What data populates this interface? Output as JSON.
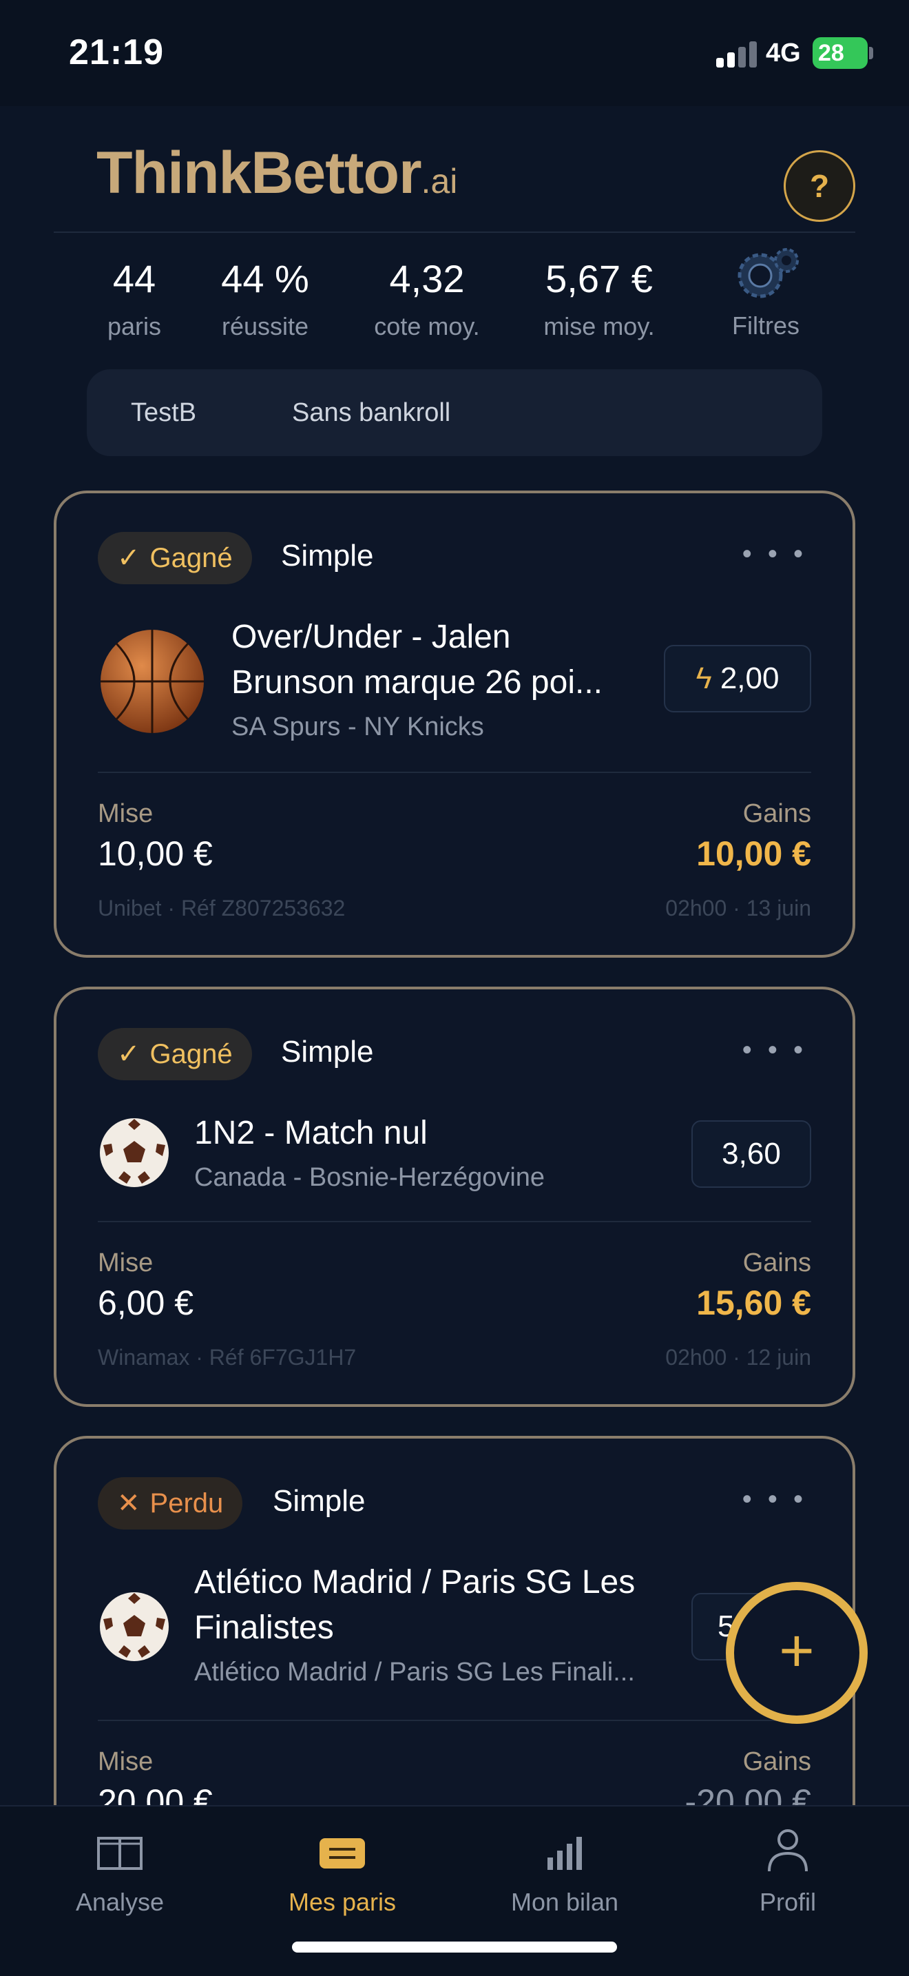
{
  "status_bar": {
    "time": "21:19",
    "network": "4G",
    "battery": "28"
  },
  "header": {
    "brand": "ThinkBettor",
    "brand_suffix": ".ai",
    "help_label": "?"
  },
  "stats": [
    {
      "value": "44",
      "label": "paris"
    },
    {
      "value": "44 %",
      "label": "réussite"
    },
    {
      "value": "4,32",
      "label": "cote moy."
    },
    {
      "value": "5,67 €",
      "label": "mise moy."
    }
  ],
  "filters_label": "Filtres",
  "bankroll_tabs": [
    "TestB",
    "Sans bankroll"
  ],
  "bets": [
    {
      "status": "Gagné",
      "status_mark": "✓",
      "type": "Simple",
      "sport_icon": "basketball-icon",
      "title_line1": "Over/Under - Jalen",
      "title_line2": "Brunson marque 26 poi...",
      "subtitle": "SA Spurs - NY Knicks",
      "odds": "2,00",
      "boosted": true,
      "stake_label": "Mise",
      "stake": "10,00 €",
      "gain_label": "Gains",
      "gain": "10,00 €",
      "ref": "Unibet · Réf Z807253632",
      "date": "02h00 · 13 juin"
    },
    {
      "status": "Gagné",
      "status_mark": "✓",
      "type": "Simple",
      "sport_icon": "soccer-ball-icon",
      "title_line1": "1N2 - Match nul",
      "title_line2": "",
      "subtitle": "Canada - Bosnie-Herzégovine",
      "odds": "3,60",
      "boosted": false,
      "stake_label": "Mise",
      "stake": "6,00 €",
      "gain_label": "Gains",
      "gain": "15,60 €",
      "ref": "Winamax · Réf 6F7GJ1H7",
      "date": "02h00 · 12 juin"
    },
    {
      "status": "Perdu",
      "status_mark": "✕",
      "type": "Simple",
      "sport_icon": "soccer-ball-icon",
      "title_line1": "Atlético Madrid / Paris SG Les",
      "title_line2": "Finalistes",
      "subtitle": "Atlético Madrid / Paris SG Les Finali...",
      "odds": "5",
      "stake_label": "Mise",
      "stake": "20,00 €",
      "gain_label": "Gains",
      "gain": "-20,00 €"
    }
  ],
  "fab_label": "+",
  "nav": [
    {
      "label": "Analyse",
      "icon": "book-icon",
      "active": false
    },
    {
      "label": "Mes paris",
      "icon": "ticket-icon",
      "active": true
    },
    {
      "label": "Mon bilan",
      "icon": "bar-chart-icon",
      "active": false
    },
    {
      "label": "Profil",
      "icon": "person-icon",
      "active": false
    }
  ],
  "colors": {
    "background": "#0c1526",
    "accent": "#e6b24c",
    "card_border": "#8a7d6b",
    "brand": "#c8a97a"
  }
}
